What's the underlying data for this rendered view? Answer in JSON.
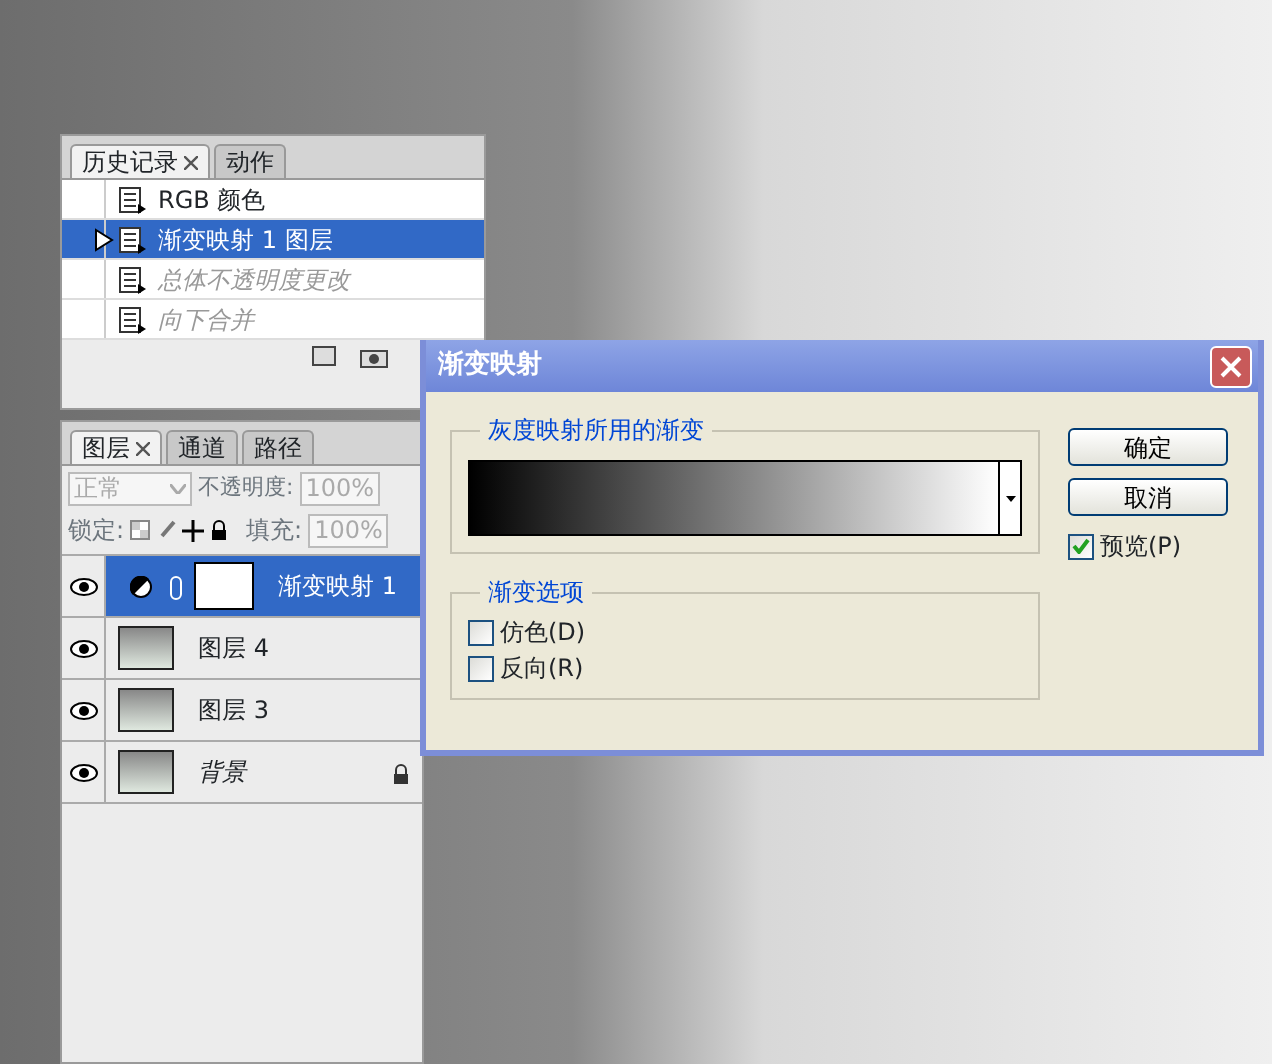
{
  "history_panel": {
    "tabs": [
      {
        "label": "历史记录",
        "selected": true,
        "closable": true
      },
      {
        "label": "动作",
        "selected": false,
        "closable": false
      }
    ],
    "items": [
      {
        "label": "RGB 颜色",
        "selected": false,
        "undone": false
      },
      {
        "label": "渐变映射 1 图层",
        "selected": true,
        "undone": false
      },
      {
        "label": "总体不透明度更改",
        "selected": false,
        "undone": true
      },
      {
        "label": "向下合并",
        "selected": false,
        "undone": true
      }
    ]
  },
  "layers_panel": {
    "tabs": [
      {
        "label": "图层",
        "selected": true,
        "closable": true
      },
      {
        "label": "通道",
        "selected": false,
        "closable": false
      },
      {
        "label": "路径",
        "selected": false,
        "closable": false
      }
    ],
    "blend_mode": {
      "value": "正常",
      "disabled": true
    },
    "opacity_label": "不透明度:",
    "opacity_value": "100%",
    "lock_label": "锁定:",
    "fill_label": "填充:",
    "fill_value": "100%",
    "layers": [
      {
        "name": "渐变映射 1",
        "kind": "adjustment",
        "selected": true,
        "visible": true,
        "locked": false,
        "italic": false
      },
      {
        "name": "图层 4",
        "kind": "image",
        "selected": false,
        "visible": true,
        "locked": false,
        "italic": false
      },
      {
        "name": "图层 3",
        "kind": "image",
        "selected": false,
        "visible": true,
        "locked": false,
        "italic": false
      },
      {
        "name": "背景",
        "kind": "image",
        "selected": false,
        "visible": true,
        "locked": true,
        "italic": true
      }
    ]
  },
  "dialog": {
    "title": "渐变映射",
    "gradient_group": "灰度映射所用的渐变",
    "options_group": "渐变选项",
    "options": [
      {
        "label": "仿色(D)",
        "checked": false
      },
      {
        "label": "反向(R)",
        "checked": false
      }
    ],
    "buttons": [
      "确定",
      "取消"
    ],
    "preview": {
      "label": "预览(P)",
      "checked": true
    }
  }
}
